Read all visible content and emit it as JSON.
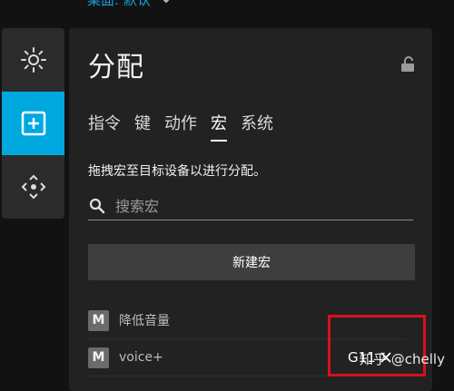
{
  "top_menu": {
    "label": "桌面: 默认"
  },
  "panel": {
    "title": "分配",
    "tabs": [
      {
        "label": "指令",
        "active": false
      },
      {
        "label": "键",
        "active": false
      },
      {
        "label": "动作",
        "active": false
      },
      {
        "label": "宏",
        "active": true
      },
      {
        "label": "系统",
        "active": false
      }
    ],
    "hint": "拖拽宏至目标设备以进行分配。",
    "search": {
      "placeholder": "搜索宏",
      "value": ""
    },
    "new_macro_label": "新建宏",
    "macros": [
      {
        "badge": "M",
        "name": "降低音量",
        "key": ""
      },
      {
        "badge": "M",
        "name": "voice+",
        "key": "G11"
      }
    ]
  },
  "side_bar": {
    "items": [
      {
        "icon": "sun-icon",
        "active": false
      },
      {
        "icon": "plus-square-icon",
        "active": true
      },
      {
        "icon": "dpad-icon",
        "active": false
      }
    ]
  },
  "watermark": "知乎 @chelly",
  "colors": {
    "accent": "#00a8e0",
    "panel_bg": "#222222",
    "highlight": "#d8111a"
  }
}
